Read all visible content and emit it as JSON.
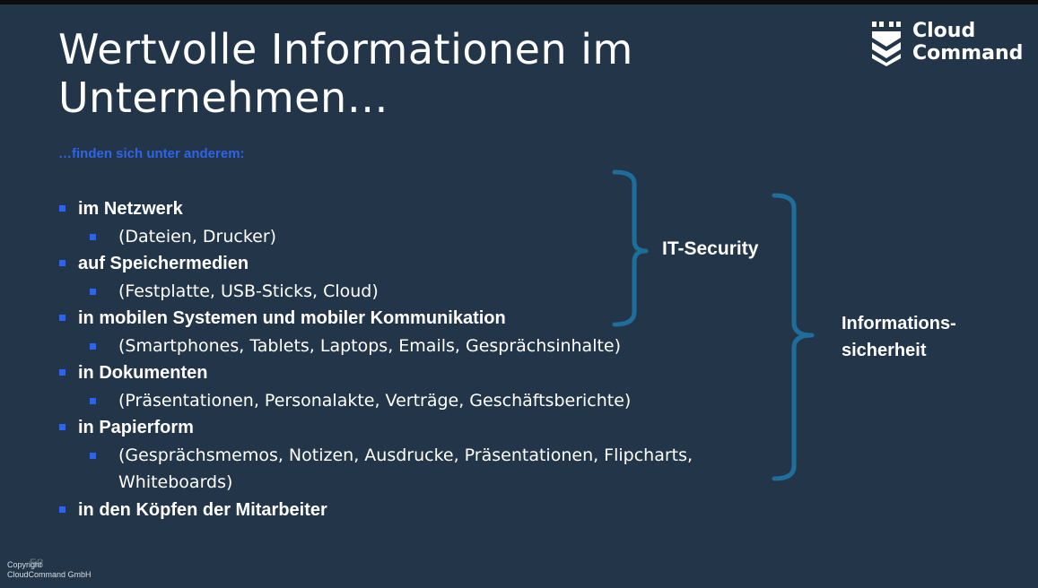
{
  "slide": {
    "title": "Wertvolle Informationen im Unternehmen…",
    "subtitle": "…finden sich unter anderem:"
  },
  "logo": {
    "line1": "Cloud",
    "line2": "Command",
    "icon": "shield-chevron-icon"
  },
  "items": [
    {
      "label": "im Netzwerk",
      "detail": "(Dateien, Drucker)"
    },
    {
      "label": "auf Speichermedien",
      "detail": "(Festplatte, USB-Sticks, Cloud)"
    },
    {
      "label": "in mobilen Systemen und mobiler Kommunikation",
      "detail": "(Smartphones, Tablets, Laptops, Emails, Gesprächsinhalte)"
    },
    {
      "label": "in Dokumenten",
      "detail": "(Präsentationen, Personalakte, Verträge, Geschäftsberichte)"
    },
    {
      "label": "in Papierform",
      "detail": "(Gesprächsmemos, Notizen, Ausdrucke, Präsentationen, Flipcharts, Whiteboards)"
    },
    {
      "label": "in den Köpfen der Mitarbeiter"
    }
  ],
  "brackets": {
    "it_security": "IT-Security",
    "info_line1": "Informations-",
    "info_line2": "sicherheit"
  },
  "colors": {
    "background": "#223549",
    "accent_blue": "#2f64e8",
    "bracket": "#1f6d9a"
  },
  "footer": {
    "line1": "Copyright",
    "line2": "CloudCommand GmbH",
    "page_number": "58"
  }
}
